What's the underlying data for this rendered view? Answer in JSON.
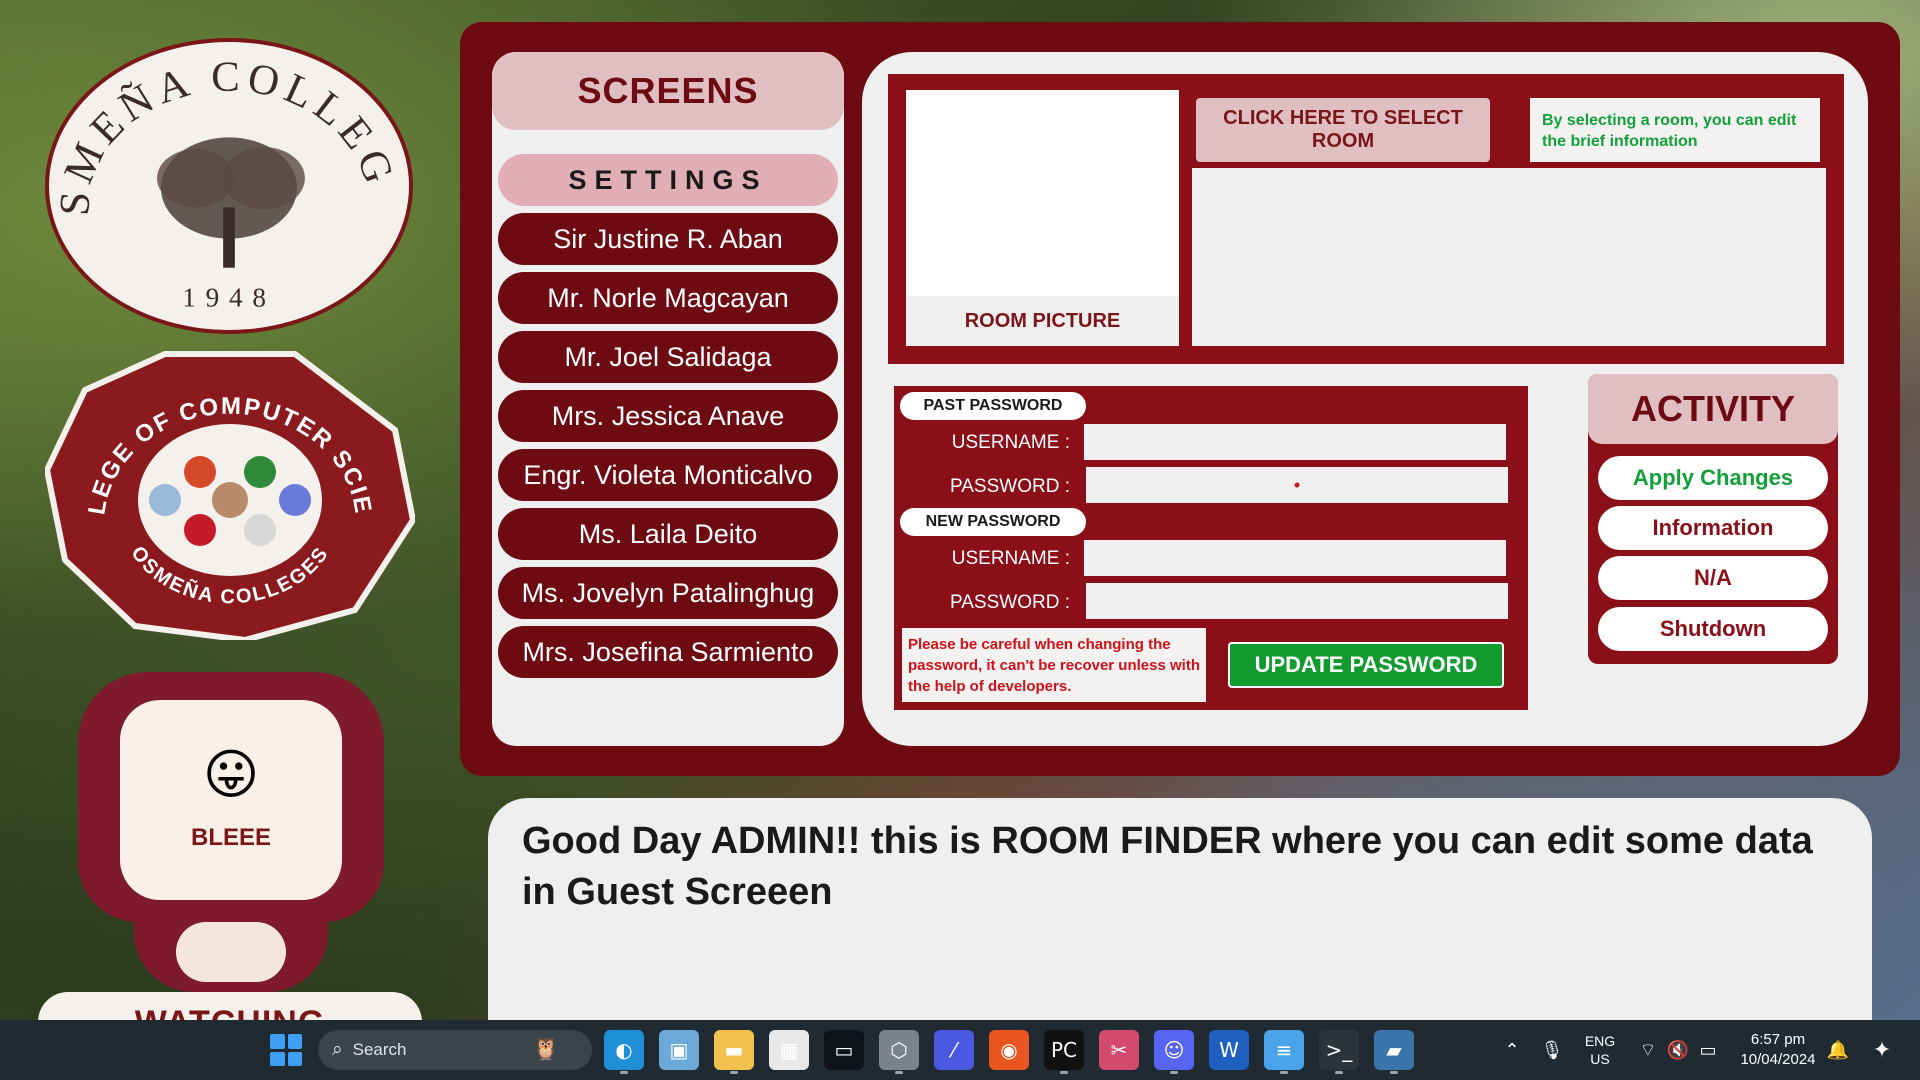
{
  "logos": {
    "osmena_top": "OSMEÑA COLLEGES",
    "osmena_year": "1948",
    "ccs_top": "COLLEGE OF COMPUTER SCIENCE",
    "ccs_bottom": "OSMEÑA COLLEGES"
  },
  "mascot": {
    "emoji": "😛",
    "name": "BLEEE",
    "caption": "WATCHING"
  },
  "sidebar": {
    "title": "SCREENS",
    "active": "SETTINGS",
    "items": [
      "Sir Justine R. Aban",
      "Mr. Norle Magcayan",
      "Mr. Joel Salidaga",
      "Mrs. Jessica Anave",
      "Engr. Violeta Monticalvo",
      "Ms. Laila Deito",
      "Ms. Jovelyn Patalinghug",
      "Mrs. Josefina Sarmiento"
    ]
  },
  "room": {
    "picture_label": "ROOM PICTURE",
    "select_button": "CLICK HERE TO SELECT ROOM",
    "hint": "By selecting a room, you can edit the brief information",
    "info_value": ""
  },
  "password": {
    "past_tag": "PAST PASSWORD",
    "new_tag": "NEW PASSWORD",
    "username_label": "USERNAME :",
    "password_label": "PASSWORD :",
    "past_username": "",
    "past_password": "•",
    "new_username": "",
    "new_password": "",
    "warning": "Please be careful when changing the password, it can't be recover unless with the help of developers.",
    "update_button": "UPDATE PASSWORD"
  },
  "activity": {
    "title": "ACTIVITY",
    "buttons": [
      "Apply Changes",
      "Information",
      "N/A",
      "Shutdown"
    ]
  },
  "greeting": "Good Day ADMIN!! this is ROOM FINDER where you can edit some data in Guest Screeen",
  "taskbar": {
    "search_placeholder": "Search",
    "apps": [
      {
        "icon": "edge-icon",
        "glyph": "◐",
        "color": "#1f8fd8"
      },
      {
        "icon": "photos-icon",
        "glyph": "▣",
        "color": "#6aa9d8"
      },
      {
        "icon": "file-explorer-icon",
        "glyph": "▬",
        "color": "#f2c14e"
      },
      {
        "icon": "store-icon",
        "glyph": "▦",
        "color": "#e8e8e8"
      },
      {
        "icon": "terminal-icon",
        "glyph": "▭",
        "color": "#101418"
      },
      {
        "icon": "unity-icon",
        "glyph": "⬡",
        "color": "#7a828a"
      },
      {
        "icon": "visual-studio-icon",
        "glyph": "⁄",
        "color": "#4b59e0"
      },
      {
        "icon": "ubuntu-icon",
        "glyph": "◉",
        "color": "#e9541f"
      },
      {
        "icon": "pycharm-icon",
        "glyph": "PC",
        "color": "#111111"
      },
      {
        "icon": "snipping-tool-icon",
        "glyph": "✂",
        "color": "#d24a6e"
      },
      {
        "icon": "discord-icon",
        "glyph": "☺",
        "color": "#5865f2"
      },
      {
        "icon": "word-icon",
        "glyph": "W",
        "color": "#1f5fbf"
      },
      {
        "icon": "notepad-icon",
        "glyph": "≡",
        "color": "#4aa3e8"
      },
      {
        "icon": "command-prompt-icon",
        "glyph": ">_",
        "color": "#2c343b"
      },
      {
        "icon": "python-icon",
        "glyph": "▰",
        "color": "#3a74a8"
      }
    ],
    "language": "ENG",
    "region": "US",
    "time": "6:57 pm",
    "date": "10/04/2024"
  },
  "colors": {
    "maroon": "#6e0b12",
    "panel_red": "#8a0f18",
    "pink": "#e0bfc3",
    "green": "#119a2e",
    "light": "#efefef"
  }
}
